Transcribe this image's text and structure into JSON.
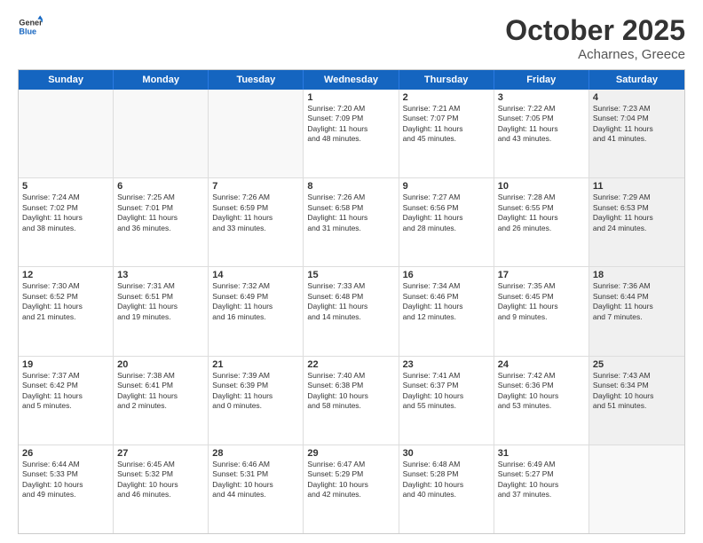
{
  "header": {
    "logo_general": "General",
    "logo_blue": "Blue",
    "month_title": "October 2025",
    "location": "Acharnes, Greece"
  },
  "days_of_week": [
    "Sunday",
    "Monday",
    "Tuesday",
    "Wednesday",
    "Thursday",
    "Friday",
    "Saturday"
  ],
  "weeks": [
    {
      "cells": [
        {
          "day": "",
          "text": "",
          "empty": true
        },
        {
          "day": "",
          "text": "",
          "empty": true
        },
        {
          "day": "",
          "text": "",
          "empty": true
        },
        {
          "day": "1",
          "text": "Sunrise: 7:20 AM\nSunset: 7:09 PM\nDaylight: 11 hours\nand 48 minutes.",
          "shaded": false
        },
        {
          "day": "2",
          "text": "Sunrise: 7:21 AM\nSunset: 7:07 PM\nDaylight: 11 hours\nand 45 minutes.",
          "shaded": false
        },
        {
          "day": "3",
          "text": "Sunrise: 7:22 AM\nSunset: 7:05 PM\nDaylight: 11 hours\nand 43 minutes.",
          "shaded": false
        },
        {
          "day": "4",
          "text": "Sunrise: 7:23 AM\nSunset: 7:04 PM\nDaylight: 11 hours\nand 41 minutes.",
          "shaded": true
        }
      ]
    },
    {
      "cells": [
        {
          "day": "5",
          "text": "Sunrise: 7:24 AM\nSunset: 7:02 PM\nDaylight: 11 hours\nand 38 minutes.",
          "shaded": false
        },
        {
          "day": "6",
          "text": "Sunrise: 7:25 AM\nSunset: 7:01 PM\nDaylight: 11 hours\nand 36 minutes.",
          "shaded": false
        },
        {
          "day": "7",
          "text": "Sunrise: 7:26 AM\nSunset: 6:59 PM\nDaylight: 11 hours\nand 33 minutes.",
          "shaded": false
        },
        {
          "day": "8",
          "text": "Sunrise: 7:26 AM\nSunset: 6:58 PM\nDaylight: 11 hours\nand 31 minutes.",
          "shaded": false
        },
        {
          "day": "9",
          "text": "Sunrise: 7:27 AM\nSunset: 6:56 PM\nDaylight: 11 hours\nand 28 minutes.",
          "shaded": false
        },
        {
          "day": "10",
          "text": "Sunrise: 7:28 AM\nSunset: 6:55 PM\nDaylight: 11 hours\nand 26 minutes.",
          "shaded": false
        },
        {
          "day": "11",
          "text": "Sunrise: 7:29 AM\nSunset: 6:53 PM\nDaylight: 11 hours\nand 24 minutes.",
          "shaded": true
        }
      ]
    },
    {
      "cells": [
        {
          "day": "12",
          "text": "Sunrise: 7:30 AM\nSunset: 6:52 PM\nDaylight: 11 hours\nand 21 minutes.",
          "shaded": false
        },
        {
          "day": "13",
          "text": "Sunrise: 7:31 AM\nSunset: 6:51 PM\nDaylight: 11 hours\nand 19 minutes.",
          "shaded": false
        },
        {
          "day": "14",
          "text": "Sunrise: 7:32 AM\nSunset: 6:49 PM\nDaylight: 11 hours\nand 16 minutes.",
          "shaded": false
        },
        {
          "day": "15",
          "text": "Sunrise: 7:33 AM\nSunset: 6:48 PM\nDaylight: 11 hours\nand 14 minutes.",
          "shaded": false
        },
        {
          "day": "16",
          "text": "Sunrise: 7:34 AM\nSunset: 6:46 PM\nDaylight: 11 hours\nand 12 minutes.",
          "shaded": false
        },
        {
          "day": "17",
          "text": "Sunrise: 7:35 AM\nSunset: 6:45 PM\nDaylight: 11 hours\nand 9 minutes.",
          "shaded": false
        },
        {
          "day": "18",
          "text": "Sunrise: 7:36 AM\nSunset: 6:44 PM\nDaylight: 11 hours\nand 7 minutes.",
          "shaded": true
        }
      ]
    },
    {
      "cells": [
        {
          "day": "19",
          "text": "Sunrise: 7:37 AM\nSunset: 6:42 PM\nDaylight: 11 hours\nand 5 minutes.",
          "shaded": false
        },
        {
          "day": "20",
          "text": "Sunrise: 7:38 AM\nSunset: 6:41 PM\nDaylight: 11 hours\nand 2 minutes.",
          "shaded": false
        },
        {
          "day": "21",
          "text": "Sunrise: 7:39 AM\nSunset: 6:39 PM\nDaylight: 11 hours\nand 0 minutes.",
          "shaded": false
        },
        {
          "day": "22",
          "text": "Sunrise: 7:40 AM\nSunset: 6:38 PM\nDaylight: 10 hours\nand 58 minutes.",
          "shaded": false
        },
        {
          "day": "23",
          "text": "Sunrise: 7:41 AM\nSunset: 6:37 PM\nDaylight: 10 hours\nand 55 minutes.",
          "shaded": false
        },
        {
          "day": "24",
          "text": "Sunrise: 7:42 AM\nSunset: 6:36 PM\nDaylight: 10 hours\nand 53 minutes.",
          "shaded": false
        },
        {
          "day": "25",
          "text": "Sunrise: 7:43 AM\nSunset: 6:34 PM\nDaylight: 10 hours\nand 51 minutes.",
          "shaded": true
        }
      ]
    },
    {
      "cells": [
        {
          "day": "26",
          "text": "Sunrise: 6:44 AM\nSunset: 5:33 PM\nDaylight: 10 hours\nand 49 minutes.",
          "shaded": false
        },
        {
          "day": "27",
          "text": "Sunrise: 6:45 AM\nSunset: 5:32 PM\nDaylight: 10 hours\nand 46 minutes.",
          "shaded": false
        },
        {
          "day": "28",
          "text": "Sunrise: 6:46 AM\nSunset: 5:31 PM\nDaylight: 10 hours\nand 44 minutes.",
          "shaded": false
        },
        {
          "day": "29",
          "text": "Sunrise: 6:47 AM\nSunset: 5:29 PM\nDaylight: 10 hours\nand 42 minutes.",
          "shaded": false
        },
        {
          "day": "30",
          "text": "Sunrise: 6:48 AM\nSunset: 5:28 PM\nDaylight: 10 hours\nand 40 minutes.",
          "shaded": false
        },
        {
          "day": "31",
          "text": "Sunrise: 6:49 AM\nSunset: 5:27 PM\nDaylight: 10 hours\nand 37 minutes.",
          "shaded": false
        },
        {
          "day": "",
          "text": "",
          "empty": true
        }
      ]
    }
  ]
}
